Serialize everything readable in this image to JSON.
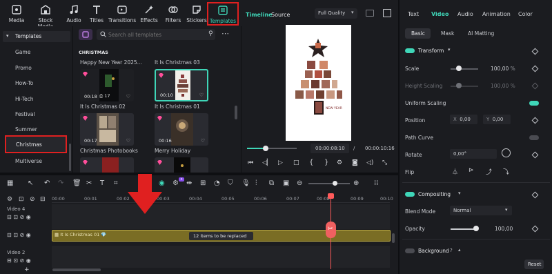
{
  "toolbar": {
    "items": [
      {
        "label": "Media",
        "icon": "media-icon"
      },
      {
        "label": "Stock Media",
        "icon": "stock-media-icon"
      },
      {
        "label": "Audio",
        "icon": "audio-icon"
      },
      {
        "label": "Titles",
        "icon": "titles-icon"
      },
      {
        "label": "Transitions",
        "icon": "transitions-icon"
      },
      {
        "label": "Effects",
        "icon": "effects-icon"
      },
      {
        "label": "Filters",
        "icon": "filters-icon"
      },
      {
        "label": "Stickers",
        "icon": "stickers-icon"
      },
      {
        "label": "Templates",
        "icon": "templates-icon"
      }
    ]
  },
  "templates_nav": {
    "header": "Templates",
    "items": [
      "Game",
      "Promo",
      "How-To",
      "Hi-Tech",
      "Festival",
      "Summer",
      "Christmas",
      "Multiverse"
    ],
    "selected": "Christmas"
  },
  "search": {
    "placeholder": "Search all templates"
  },
  "grid": {
    "section": "CHRISTMAS",
    "row_titles": [
      "Happy New Year 2025...",
      "It Is Christmas 03",
      "It Is Christmas 02",
      "It Is Christmas 01",
      "Christmas Photobooks",
      "Merry Holiday"
    ],
    "thumbs": [
      {
        "duration": "00:18",
        "uses": "17"
      },
      {
        "duration": "00:10",
        "uses": ""
      },
      {
        "duration": "00:17",
        "uses": ""
      },
      {
        "duration": "00:16",
        "uses": ""
      }
    ]
  },
  "preview": {
    "tabs": [
      "Timeline",
      "Source"
    ],
    "quality": "Full Quality",
    "current_time": "00:00:08:10",
    "total_time": "00:00:10:16",
    "overlay_text": "NEW YEAR",
    "progress": 0.38
  },
  "right": {
    "tabs": [
      "Text",
      "Video",
      "Audio",
      "Animation",
      "Color"
    ],
    "subtabs": [
      "Basic",
      "Mask",
      "AI Matting"
    ],
    "transform": "Transform",
    "scale_label": "Scale",
    "scale_value": "100,00",
    "scale_unit": "%",
    "height_scaling_label": "Height Scaling",
    "height_scaling_value": "100,00",
    "uniform_scaling_label": "Uniform Scaling",
    "position_label": "Position",
    "pos_x_label": "X",
    "pos_x": "0,00",
    "pos_y_label": "Y",
    "pos_y": "0,00",
    "path_curve_label": "Path Curve",
    "rotate_label": "Rotate",
    "rotate_value": "0,00°",
    "flip_label": "Flip",
    "compositing": "Compositing",
    "blend_label": "Blend Mode",
    "blend_value": "Normal",
    "opacity_label": "Opacity",
    "opacity_value": "100,00",
    "background": "Background",
    "reset": "Reset"
  },
  "timeline": {
    "ruler": [
      "00:00",
      "00:01",
      "00:02",
      "00:03",
      "00:04",
      "00:05",
      "00:06",
      "00:07",
      "00:08",
      "00:09",
      "00:10"
    ],
    "tracks": [
      "Video 4",
      "Video 2"
    ],
    "clip_title": "It Is Christmas 01",
    "clip_badge": "12 items to be replaced"
  }
}
